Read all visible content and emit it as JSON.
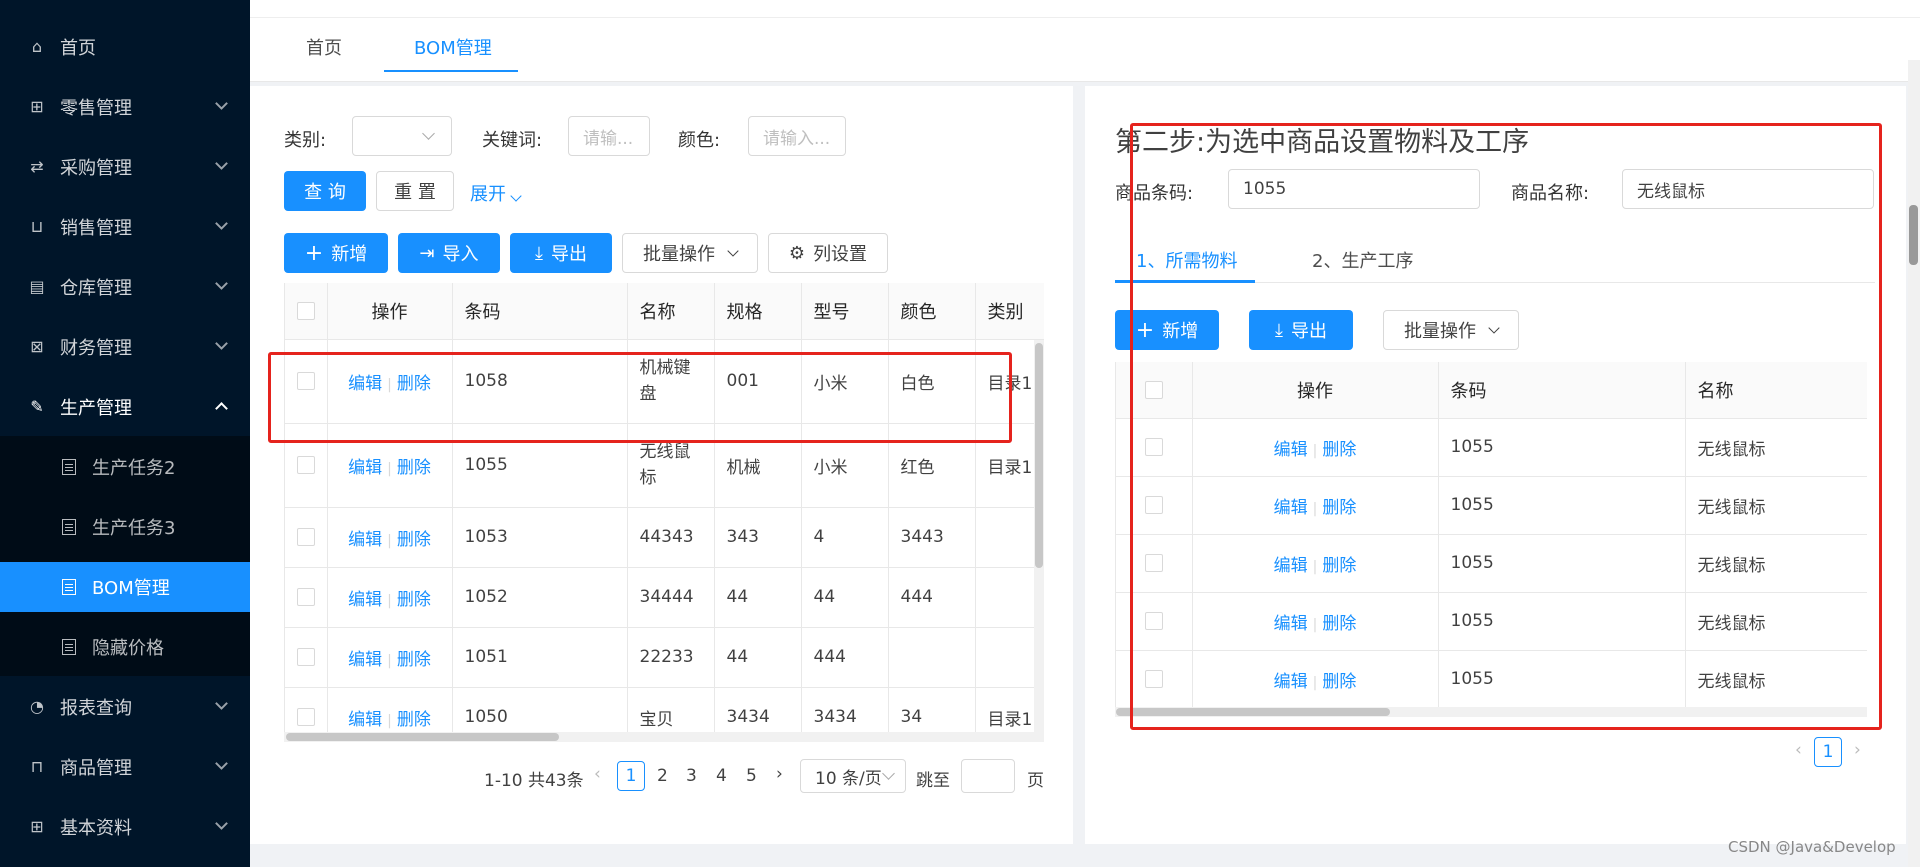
{
  "sidebar": {
    "items": [
      {
        "label": "首页",
        "icon": "home-icon"
      },
      {
        "label": "零售管理",
        "icon": "gift-icon"
      },
      {
        "label": "采购管理",
        "icon": "swap-icon"
      },
      {
        "label": "销售管理",
        "icon": "cart-icon"
      },
      {
        "label": "仓库管理",
        "icon": "warehouse-icon"
      },
      {
        "label": "财务管理",
        "icon": "finance-icon"
      },
      {
        "label": "生产管理",
        "icon": "wrench-icon"
      },
      {
        "label": "报表查询",
        "icon": "pie-chart-icon"
      },
      {
        "label": "商品管理",
        "icon": "shopping-bag-icon"
      },
      {
        "label": "基本资料",
        "icon": "grid-icon"
      }
    ],
    "sub_items": [
      {
        "label": "生产任务2"
      },
      {
        "label": "生产任务3"
      },
      {
        "label": "BOM管理"
      },
      {
        "label": "隐藏价格"
      }
    ]
  },
  "page_tabs": [
    {
      "label": "首页"
    },
    {
      "label": "BOM管理"
    }
  ],
  "left": {
    "filters": {
      "category_label": "类别:",
      "keyword_label": "关键词:",
      "keyword_placeholder": "请输...",
      "color_label": "颜色:",
      "color_placeholder": "请输入..."
    },
    "query_label": "查 询",
    "reset_label": "重 置",
    "expand_label": "展开",
    "toolbar": {
      "add": "新增",
      "import": "导入",
      "export": "导出",
      "batch": "批量操作",
      "columns": "列设置"
    },
    "table": {
      "headers": [
        "操作",
        "条码",
        "名称",
        "规格",
        "型号",
        "颜色",
        "类别"
      ],
      "edit": "编辑",
      "delete": "删除",
      "rows": [
        {
          "barcode": "1058",
          "name": "机械键盘",
          "spec": "001",
          "model": "小米",
          "color": "白色",
          "category": "目录1"
        },
        {
          "barcode": "1055",
          "name": "无线鼠标",
          "spec": "机械",
          "model": "小米",
          "color": "红色",
          "category": "目录1"
        },
        {
          "barcode": "1053",
          "name": "44343",
          "spec": "343",
          "model": "4",
          "color": "3443",
          "category": ""
        },
        {
          "barcode": "1052",
          "name": "34444",
          "spec": "44",
          "model": "44",
          "color": "444",
          "category": ""
        },
        {
          "barcode": "1051",
          "name": "22233",
          "spec": "44",
          "model": "444",
          "color": "",
          "category": ""
        },
        {
          "barcode": "1050",
          "name": "宝贝",
          "spec": "3434",
          "model": "3434",
          "color": "34",
          "category": "目录1"
        }
      ]
    },
    "pagination": {
      "total": "1-10 共43条",
      "pages": [
        "1",
        "2",
        "3",
        "4",
        "5"
      ],
      "page_size": "10 条/页",
      "jump_label": "跳至",
      "page_suffix": "页"
    }
  },
  "right": {
    "title": "第二步:为选中商品设置物料及工序",
    "barcode_label": "商品条码:",
    "barcode_value": "1055",
    "name_label": "商品名称:",
    "name_value": "无线鼠标",
    "tabs": [
      "1、所需物料",
      "2、生产工序"
    ],
    "toolbar": {
      "add": "新增",
      "export": "导出",
      "batch": "批量操作"
    },
    "table": {
      "headers": [
        "操作",
        "条码",
        "名称"
      ],
      "edit": "编辑",
      "delete": "删除",
      "rows": [
        {
          "barcode": "1055",
          "name": "无线鼠标"
        },
        {
          "barcode": "1055",
          "name": "无线鼠标"
        },
        {
          "barcode": "1055",
          "name": "无线鼠标"
        },
        {
          "barcode": "1055",
          "name": "无线鼠标"
        },
        {
          "barcode": "1055",
          "name": "无线鼠标"
        }
      ]
    },
    "pagination": {
      "page": "1"
    }
  },
  "watermark": "CSDN @Java&Develop",
  "colors": {
    "primary": "#1890ff",
    "sidebar": "#001529",
    "highlight_box": "#e5231d"
  }
}
